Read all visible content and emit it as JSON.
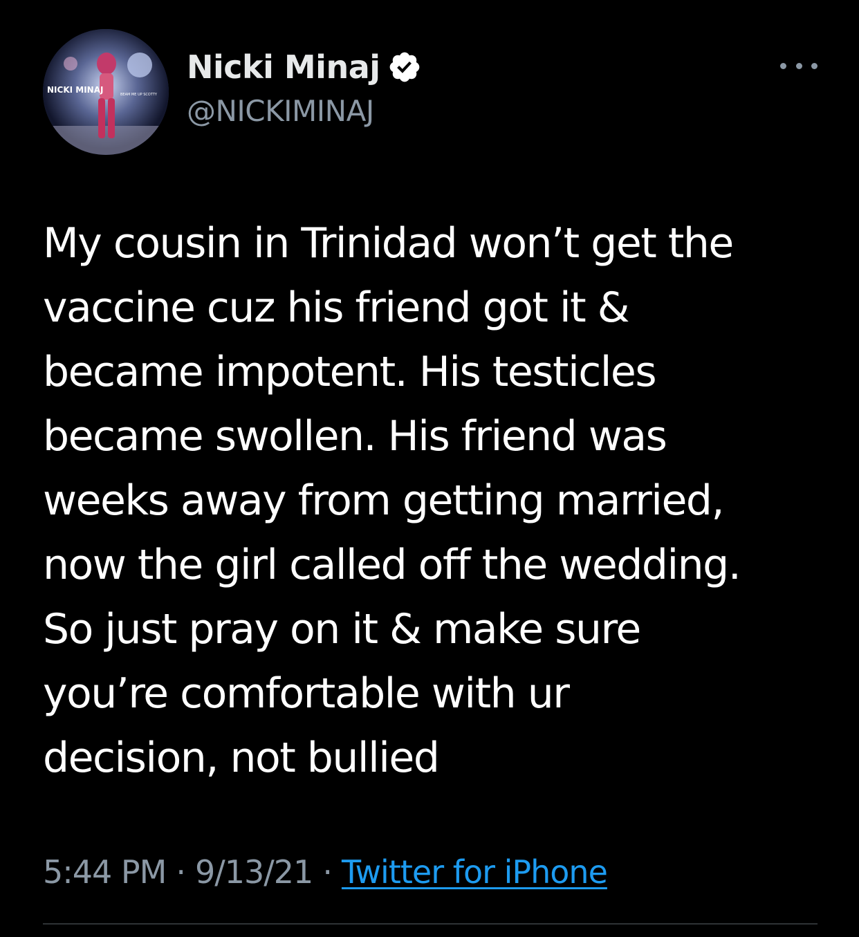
{
  "tweet": {
    "display_name": "Nicki Minaj",
    "handle": "@NICKIMINAJ",
    "verified": true,
    "avatar_text": "NICKI MINAJ",
    "avatar_subtext": "BEAM ME UP SCOTTY",
    "more_icon": "more-horizontal-icon",
    "text": "My cousin in Trinidad won’t get the\nvaccine cuz his friend got it &\nbecame impotent. His testicles\nbecame swollen. His friend was\nweeks away from getting married,\nnow the girl called off the wedding.\nSo just pray on it & make sure\nyou’re comfortable with ur\ndecision, not bullied",
    "time": "5:44 PM",
    "date": "9/13/21",
    "separator": "·",
    "source": "Twitter for iPhone"
  },
  "colors": {
    "background": "#000000",
    "text": "#ffffff",
    "secondary": "#8b98a5",
    "link": "#1d9bf0",
    "divider": "#2f3336"
  }
}
